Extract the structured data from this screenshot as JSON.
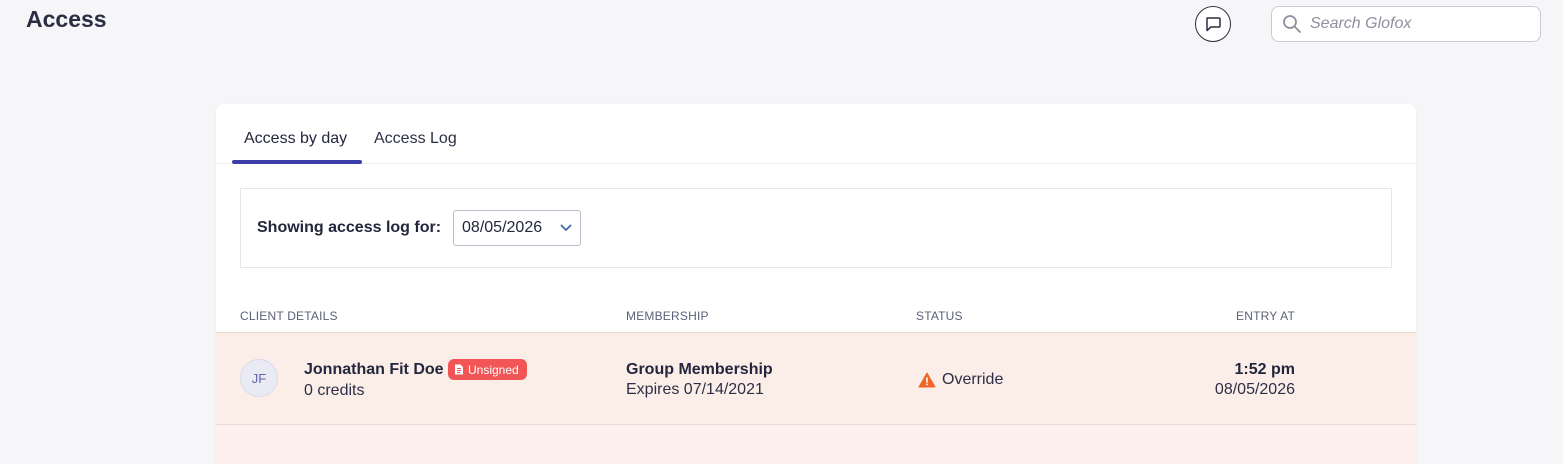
{
  "header": {
    "title": "Access",
    "search_placeholder": "Search Glofox"
  },
  "tabs": [
    {
      "label": "Access by day",
      "active": true
    },
    {
      "label": "Access Log",
      "active": false
    }
  ],
  "filter": {
    "label": "Showing access log for:",
    "date_value": "08/05/2026"
  },
  "table": {
    "columns": [
      "CLIENT DETAILS",
      "MEMBERSHIP",
      "STATUS",
      "ENTRY AT"
    ],
    "rows": [
      {
        "initials": "JF",
        "name": "Jonnathan Fit Doe",
        "badge": "Unsigned",
        "credits": "0 credits",
        "membership": "Group Membership",
        "expires": "Expires 07/14/2021",
        "status": "Override",
        "time": "1:52 pm",
        "date": "08/05/2026"
      }
    ]
  },
  "colors": {
    "accent": "#3b3ea8",
    "badge": "#f25555",
    "row_warning_bg": "#fbeee9",
    "warning_icon": "#f0652a"
  }
}
